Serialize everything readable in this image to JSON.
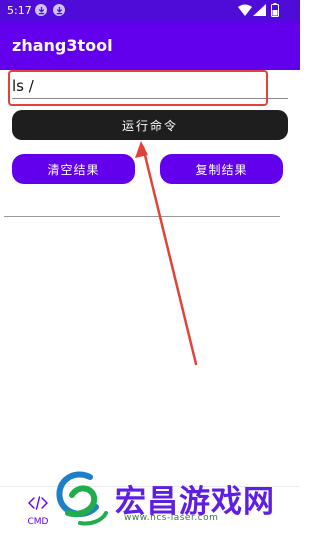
{
  "status_bar": {
    "time": "5:17",
    "bg_color": "#4f0bd8"
  },
  "app_bar": {
    "title": "zhang3tool",
    "bg_color": "#6200ee"
  },
  "command": {
    "value": "ls /",
    "highlight_color": "#e0433a"
  },
  "actions": {
    "run_label": "运行命令",
    "clear_label": "清空结果",
    "copy_label": "复制结果",
    "accent": "#6200ee"
  },
  "result": {
    "text": ""
  },
  "bottom_nav": {
    "items": [
      {
        "label": "CMD",
        "icon": "code-icon"
      }
    ]
  },
  "watermark": {
    "title": "宏昌游戏网",
    "url": "www.hcs-laser.com"
  }
}
